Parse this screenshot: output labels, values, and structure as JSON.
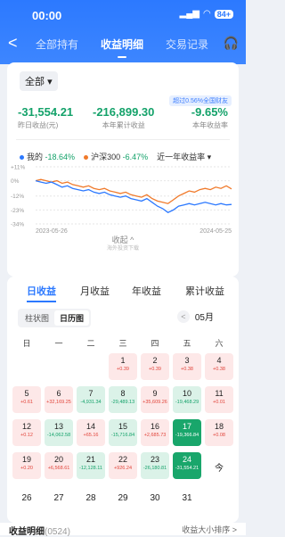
{
  "status": {
    "time": "00:00",
    "battery": "84+"
  },
  "nav": {
    "back": "<",
    "tabs": [
      "全部持有",
      "收益明细",
      "交易记录"
    ],
    "support": "🎧"
  },
  "summary": {
    "filter": "全部",
    "badge": "超过0.56%全国财友",
    "yesterday": {
      "value": "-31,554.21",
      "label": "昨日收益(元)"
    },
    "year_profit": {
      "value": "-216,899.30",
      "label": "本年累计收益"
    },
    "year_rate": {
      "value": "-9.65%",
      "label": "本年收益率"
    }
  },
  "legend": {
    "mine_label": "我的",
    "mine_value": "-18.64%",
    "csi_label": "沪深300",
    "csi_value": "-6.47%",
    "period": "近一年收益率"
  },
  "chart_data": {
    "type": "line",
    "yticks": [
      "+11%",
      "0%",
      "-12%",
      "-23%",
      "-34%"
    ],
    "ylim": [
      -34,
      11
    ],
    "x_start": "2023-05-26",
    "x_end": "2024-05-25",
    "series": [
      {
        "name": "我的",
        "color": "#2c79ff",
        "values": [
          0,
          -1,
          -2,
          -1,
          -3,
          -5,
          -4,
          -6,
          -7,
          -8,
          -7,
          -9,
          -10,
          -9,
          -11,
          -12,
          -13,
          -12,
          -14,
          -15,
          -16,
          -14,
          -17,
          -20,
          -22,
          -25,
          -23,
          -20,
          -19,
          -18,
          -19,
          -18,
          -17,
          -18,
          -19,
          -18,
          -19,
          -18.64
        ]
      },
      {
        "name": "沪深300",
        "color": "#f07a2b",
        "values": [
          0,
          1,
          0,
          -1,
          0,
          -2,
          -1,
          -3,
          -4,
          -5,
          -4,
          -6,
          -7,
          -6,
          -8,
          -9,
          -10,
          -9,
          -11,
          -12,
          -13,
          -11,
          -14,
          -16,
          -17,
          -18,
          -15,
          -12,
          -10,
          -8,
          -9,
          -7,
          -6,
          -7,
          -5,
          -6,
          -4,
          -6.47
        ]
      }
    ]
  },
  "collapse_label": "收起 ^",
  "watermark": "海外投资下载",
  "period_tabs": [
    "日收益",
    "月收益",
    "年收益",
    "累计收益"
  ],
  "view_toggle": [
    "柱状图",
    "日历图"
  ],
  "month": {
    "prev": "<",
    "label": "05月"
  },
  "weekdays": [
    "日",
    "一",
    "二",
    "三",
    "四",
    "五",
    "六"
  ],
  "calendar": [
    {
      "day": "1",
      "amount": "+0.39",
      "tone": "r",
      "col": 3,
      "row": 0
    },
    {
      "day": "2",
      "amount": "+0.39",
      "tone": "r",
      "col": 4,
      "row": 0
    },
    {
      "day": "3",
      "amount": "+0.38",
      "tone": "r",
      "col": 5,
      "row": 0
    },
    {
      "day": "4",
      "amount": "+0.38",
      "tone": "r",
      "col": 6,
      "row": 0
    },
    {
      "day": "5",
      "amount": "+0.61",
      "tone": "r",
      "col": 0,
      "row": 1
    },
    {
      "day": "6",
      "amount": "+32,169.25",
      "tone": "r",
      "col": 1,
      "row": 1
    },
    {
      "day": "7",
      "amount": "-4,931.34",
      "tone": "g",
      "col": 2,
      "row": 1
    },
    {
      "day": "8",
      "amount": "-29,489.13",
      "tone": "g",
      "col": 3,
      "row": 1
    },
    {
      "day": "9",
      "amount": "+35,609.26",
      "tone": "r",
      "col": 4,
      "row": 1
    },
    {
      "day": "10",
      "amount": "-19,468.29",
      "tone": "g",
      "col": 5,
      "row": 1
    },
    {
      "day": "11",
      "amount": "+0.01",
      "tone": "r",
      "col": 6,
      "row": 1
    },
    {
      "day": "12",
      "amount": "+0.12",
      "tone": "r",
      "col": 0,
      "row": 2
    },
    {
      "day": "13",
      "amount": "-14,062.58",
      "tone": "g",
      "col": 1,
      "row": 2
    },
    {
      "day": "14",
      "amount": "+65.16",
      "tone": "r",
      "col": 2,
      "row": 2
    },
    {
      "day": "15",
      "amount": "-15,716.84",
      "tone": "g",
      "col": 3,
      "row": 2
    },
    {
      "day": "16",
      "amount": "+2,685.73",
      "tone": "r",
      "col": 4,
      "row": 2
    },
    {
      "day": "17",
      "amount": "-19,366.84",
      "tone": "gs",
      "col": 5,
      "row": 2
    },
    {
      "day": "18",
      "amount": "+0.08",
      "tone": "r",
      "col": 6,
      "row": 2
    },
    {
      "day": "19",
      "amount": "+0.20",
      "tone": "r",
      "col": 0,
      "row": 3
    },
    {
      "day": "20",
      "amount": "+6,568.61",
      "tone": "r",
      "col": 1,
      "row": 3
    },
    {
      "day": "21",
      "amount": "-12,128.11",
      "tone": "g",
      "col": 2,
      "row": 3
    },
    {
      "day": "22",
      "amount": "+926.24",
      "tone": "r",
      "col": 3,
      "row": 3
    },
    {
      "day": "23",
      "amount": "-26,180.81",
      "tone": "g",
      "col": 4,
      "row": 3
    },
    {
      "day": "24",
      "amount": "-31,554.21",
      "tone": "gs",
      "col": 5,
      "row": 3
    },
    {
      "day": "今",
      "amount": "",
      "tone": "n",
      "col": 6,
      "row": 3
    },
    {
      "day": "26",
      "amount": "",
      "tone": "n",
      "col": 0,
      "row": 4
    },
    {
      "day": "27",
      "amount": "",
      "tone": "n",
      "col": 1,
      "row": 4
    },
    {
      "day": "28",
      "amount": "",
      "tone": "n",
      "col": 2,
      "row": 4
    },
    {
      "day": "29",
      "amount": "",
      "tone": "n",
      "col": 3,
      "row": 4
    },
    {
      "day": "30",
      "amount": "",
      "tone": "n",
      "col": 4,
      "row": 4
    },
    {
      "day": "31",
      "amount": "",
      "tone": "n",
      "col": 5,
      "row": 4
    }
  ],
  "footer": {
    "title": "收益明细",
    "date": "(0524)",
    "sort": "收益大小排序 >"
  }
}
